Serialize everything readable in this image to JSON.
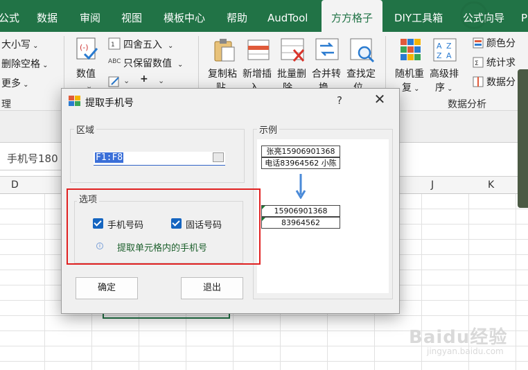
{
  "ribbon": {
    "tabs": [
      {
        "label": "公式"
      },
      {
        "label": "数据"
      },
      {
        "label": "审阅"
      },
      {
        "label": "视图"
      },
      {
        "label": "模板中心"
      },
      {
        "label": "帮助"
      },
      {
        "label": "AudTool"
      },
      {
        "label": "方方格子",
        "active": true
      },
      {
        "label": "DIY工具箱"
      },
      {
        "label": "公式向导"
      },
      {
        "label": "P"
      }
    ],
    "left_group": {
      "items": [
        "大小写",
        "删除空格",
        "更多"
      ],
      "group_label": "理"
    },
    "number_group": {
      "big_button": "数值",
      "round_label": "四舍五入",
      "keep_value_label": "只保留数值"
    },
    "tools": [
      {
        "line1": "复制粘",
        "line2": "贴"
      },
      {
        "line1": "新增插",
        "line2": "入"
      },
      {
        "line1": "批量删",
        "line2": "除"
      },
      {
        "line1": "合并转",
        "line2": "换"
      },
      {
        "line1": "查找定",
        "line2": "位"
      }
    ],
    "analysis": {
      "random_line1": "随机重",
      "random_line2": "复",
      "sort_line1": "高级排",
      "sort_line2": "序",
      "color_label": "颜色分",
      "stats_label": "统计求",
      "data_label": "数据分",
      "group_label": "数据分析"
    }
  },
  "sheet": {
    "namebox_text": "手机号180",
    "columns": [
      "D",
      "J",
      "K"
    ]
  },
  "dialog": {
    "title": "提取手机号",
    "help": "?",
    "close": "✕",
    "range_legend": "区域",
    "range_value": "F1:F8",
    "options_legend": "选项",
    "opt_mobile": "手机号码",
    "opt_landline": "固话号码",
    "info_text": "提取单元格内的手机号",
    "ok_label": "确定",
    "exit_label": "退出",
    "example_legend": "示例",
    "example_before": [
      "张亮15906901368",
      "电话83964562 小陈"
    ],
    "example_after": [
      "15906901368",
      "83964562"
    ]
  },
  "colors": {
    "accent": "#217346",
    "checkbox": "#1565c0",
    "highlight": "#e02020",
    "arrow": "#4a8ad8"
  },
  "watermark": {
    "main": "Baidu经验",
    "sub": "jingyan.baidu.com"
  }
}
